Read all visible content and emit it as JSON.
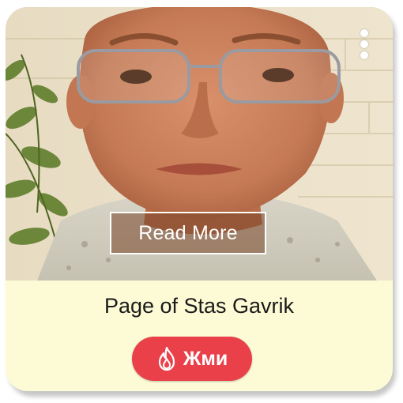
{
  "card": {
    "read_more_label": "Read More",
    "title": "Page of Stas Gavrik",
    "cta_label": "Жми",
    "cta_icon": "fire-icon",
    "menu_icon": "more-vertical-icon"
  },
  "colors": {
    "card_background": "#fdfbd6",
    "cta_background": "#e9404a",
    "text": "#1a1a1a"
  }
}
